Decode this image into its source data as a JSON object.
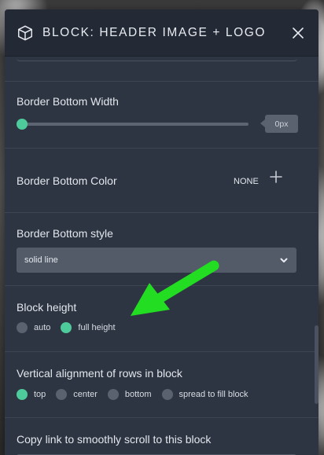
{
  "header": {
    "title": "BLOCK: HEADER IMAGE + LOGO"
  },
  "border_width": {
    "label": "Border Bottom Width",
    "value": "0px",
    "slider_fraction": 0
  },
  "border_color": {
    "label": "Border Bottom Color",
    "value": "NONE"
  },
  "border_style": {
    "label": "Border Bottom style",
    "selected": "solid line"
  },
  "block_height": {
    "label": "Block height",
    "options": [
      "auto",
      "full height"
    ],
    "selected": "full height"
  },
  "vertical_alignment": {
    "label": "Vertical alignment of rows in block",
    "options": [
      "top",
      "center",
      "bottom",
      "spread to fill block"
    ],
    "selected": "top"
  },
  "copy_link": {
    "label": "Copy link to smoothly scroll to this block"
  },
  "colors": {
    "accent": "#4ecb9b",
    "arrow": "#22dd22",
    "panel": "#2e3542",
    "header": "#232935"
  }
}
